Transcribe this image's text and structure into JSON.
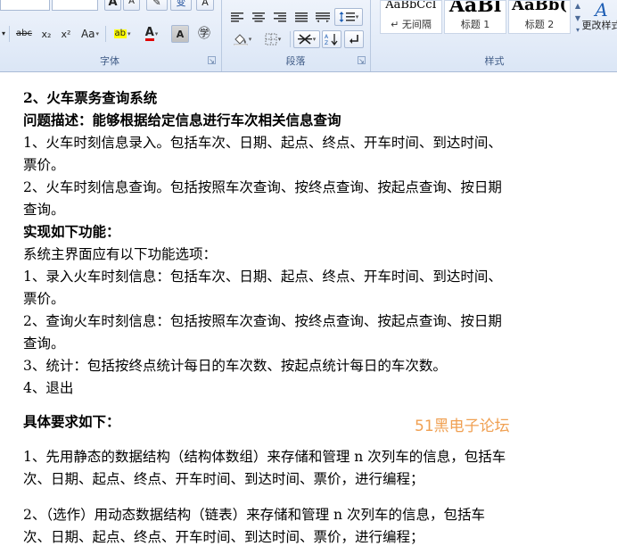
{
  "ribbon": {
    "font_group": {
      "label": "字体",
      "buttons": {
        "strike": "abc",
        "subscript": "x₂",
        "superscript": "x²",
        "change_case": "Aa",
        "highlight": "ab",
        "font_color": "A",
        "char_shading": "A",
        "enclose": "㊫",
        "grow": "A",
        "shrink": "A",
        "clear": "✎",
        "phonetic": "变",
        "border": "A"
      }
    },
    "paragraph_group": {
      "label": "段落"
    },
    "styles_group": {
      "label": "样式",
      "styles": [
        {
          "sample": "AaBbCcI",
          "name": "↵ 无间隔"
        },
        {
          "sample": "AaBl",
          "name": "标题 1"
        },
        {
          "sample": "AaBb(",
          "name": "标题 2"
        }
      ],
      "change_styles": "更改样式"
    }
  },
  "document": {
    "lines": [
      "2、火车票务查询系统",
      "问题描述：能够根据给定信息进行车次相关信息查询",
      "1、火车时刻信息录入。包括车次、日期、起点、终点、开车时间、到达时间、",
      "票价。",
      "2、火车时刻信息查询。包括按照车次查询、按终点查询、按起点查询、按日期",
      "查询。",
      "实现如下功能：",
      "系统主界面应有以下功能选项：",
      "1、录入火车时刻信息：包括车次、日期、起点、终点、开车时间、到达时间、",
      "票价。",
      "2、查询火车时刻信息：包括按照车次查询、按终点查询、按起点查询、按日期",
      "查询。",
      "3、统计：包括按终点统计每日的车次数、按起点统计每日的车次数。",
      "4、退出",
      "具体要求如下：",
      "1、先用静态的数据结构（结构体数组）来存储和管理 n 次列车的信息，包括车",
      "次、日期、起点、终点、开车时间、到达时间、票价，进行编程；",
      "2、（选作）用动态数据结构（链表）来存储和管理 n 次列车的信息，包括车",
      "次、日期、起点、终点、开车时间、到达时间、票价，进行编程；"
    ],
    "watermark": "51黑电子论坛"
  }
}
